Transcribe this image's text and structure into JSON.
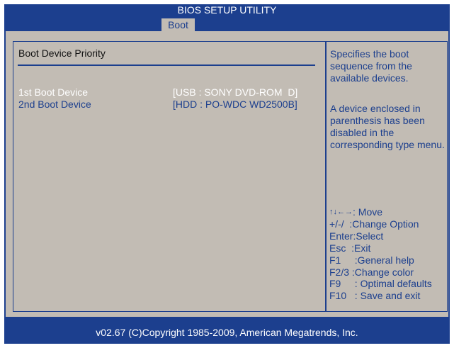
{
  "header": {
    "title": "BIOS SETUP UTILITY",
    "tabs": [
      {
        "label": "Boot",
        "active": true
      }
    ]
  },
  "main": {
    "section_title": "Boot Device Priority",
    "boot_devices": [
      {
        "label": "1st Boot Device",
        "value": "[USB : SONY DVD-ROM  D]",
        "selected": true
      },
      {
        "label": "2nd Boot Device",
        "value": "[HDD : PO-WDC WD2500B]",
        "selected": false
      }
    ]
  },
  "help": {
    "description": "Specifies the boot sequence from the available devices.",
    "note": "A device enclosed in parenthesis has been disabled in the corresponding type menu.",
    "keys": [
      {
        "key": "↑↓←→",
        "action": ": Move"
      },
      {
        "key": "+/-/",
        "action": "  :Change Option"
      },
      {
        "key": "Enter",
        "action": ":Select"
      },
      {
        "key": "Esc",
        "action": "  :Exit"
      },
      {
        "key": "F1",
        "action": "     :General help"
      },
      {
        "key": "F2/3",
        "action": " :Change color"
      },
      {
        "key": "F9",
        "action": "     : Optimal defaults"
      },
      {
        "key": "F10",
        "action": "   : Save and exit"
      }
    ]
  },
  "footer": {
    "copyright": "v02.67  (C)Copyright 1985-2009, American Megatrends, Inc."
  },
  "colors": {
    "bios_blue": "#1c3f8e",
    "panel_gray": "#c2bcb4",
    "highlight": "#ffffff"
  }
}
